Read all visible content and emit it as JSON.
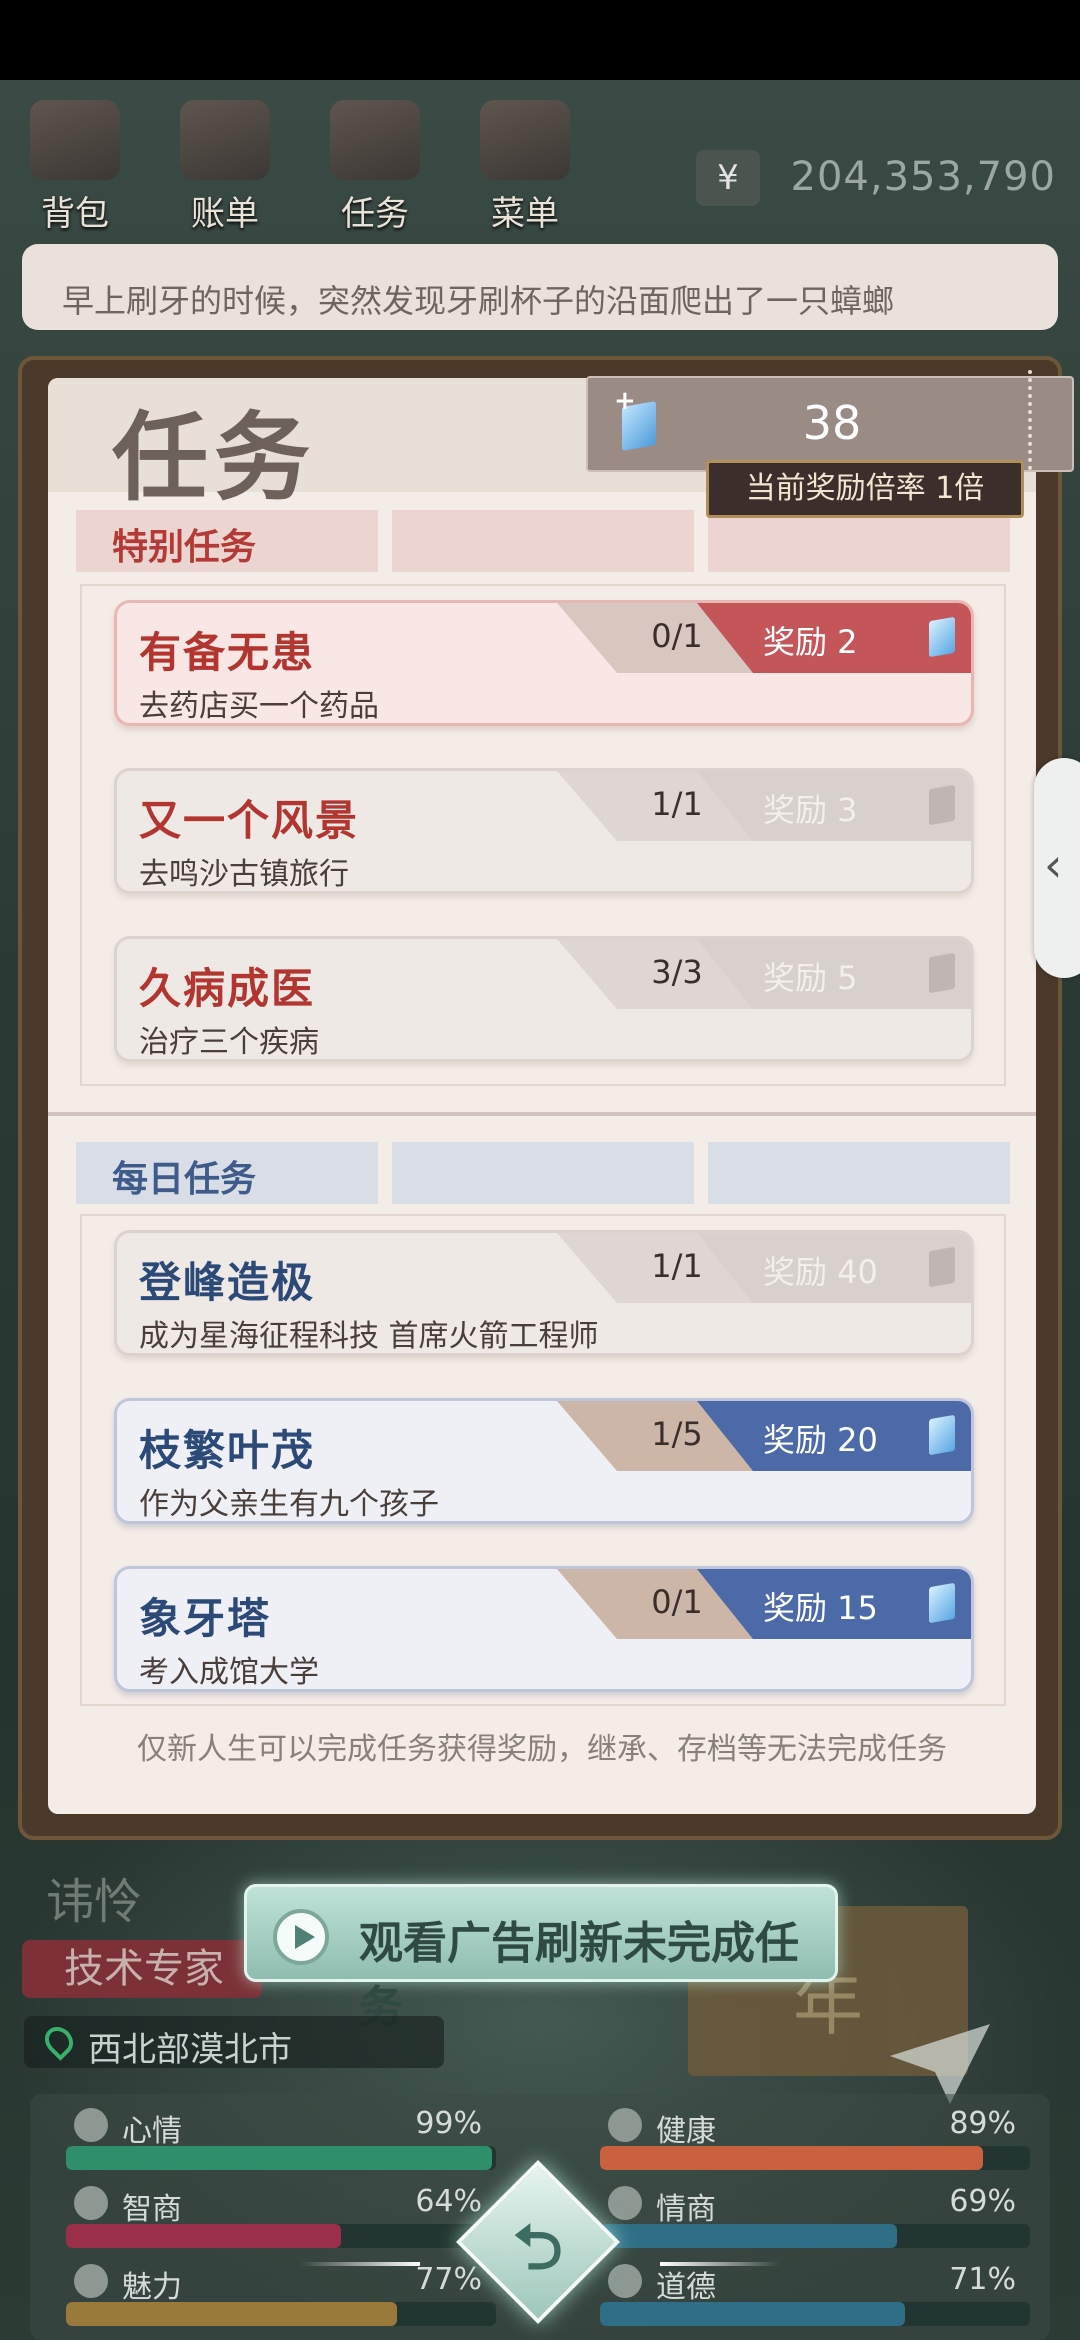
{
  "topbar": {
    "items": [
      {
        "label": "背包",
        "icon": "bag-icon"
      },
      {
        "label": "账单",
        "icon": "bill-icon"
      },
      {
        "label": "任务",
        "icon": "task-icon"
      },
      {
        "label": "菜单",
        "icon": "menu-icon"
      }
    ],
    "currency_symbol": "¥",
    "money": "204,353,790"
  },
  "story_text": "早上刷牙的时候，突然发现牙刷杯子的沿面爬出了一只蟑螂",
  "dialog": {
    "title": "任务",
    "points": "38",
    "multiplier_label": "当前奖励倍率 1倍",
    "special_tab": "特别任务",
    "daily_tab": "每日任务",
    "special_tasks": [
      {
        "name": "有备无患",
        "desc": "去药店买一个药品",
        "progress": "0/1",
        "reward": "奖励 2",
        "state": "active"
      },
      {
        "name": "又一个风景",
        "desc": "去鸣沙古镇旅行",
        "progress": "1/1",
        "reward": "奖励 3",
        "state": "done"
      },
      {
        "name": "久病成医",
        "desc": "治疗三个疾病",
        "progress": "3/3",
        "reward": "奖励 5",
        "state": "done"
      }
    ],
    "daily_tasks": [
      {
        "name": "登峰造极",
        "desc": "成为星海征程科技 首席火箭工程师",
        "progress": "1/1",
        "reward": "奖励 40",
        "state": "done"
      },
      {
        "name": "枝繁叶茂",
        "desc": "作为父亲生有九个孩子",
        "progress": "1/5",
        "reward": "奖励 20",
        "state": "active"
      },
      {
        "name": "象牙塔",
        "desc": "考入成馆大学",
        "progress": "0/1",
        "reward": "奖励 15",
        "state": "active"
      }
    ],
    "footnote": "仅新人生可以完成任务获得奖励，继承、存档等无法完成任务"
  },
  "character": {
    "name": "讳怜",
    "role": "技术专家",
    "location": "西北部漠北市",
    "year_suffix": "年"
  },
  "ad_button": "观看广告刷新未完成任务",
  "stats": [
    {
      "label": "心情",
      "value": "99%",
      "fraction": 0.99,
      "color": "#2e8f6a",
      "icon": "smile-icon"
    },
    {
      "label": "健康",
      "value": "89%",
      "fraction": 0.89,
      "color": "#c9603e",
      "icon": "heart-icon"
    },
    {
      "label": "智商",
      "value": "64%",
      "fraction": 0.64,
      "color": "#9a2f4a",
      "icon": "bulb-icon"
    },
    {
      "label": "情商",
      "value": "69%",
      "fraction": 0.69,
      "color": "#2f6e86",
      "icon": "apple-icon"
    },
    {
      "label": "魅力",
      "value": "77%",
      "fraction": 0.77,
      "color": "#9a7a3a",
      "icon": "sparkle-icon"
    },
    {
      "label": "道德",
      "value": "71%",
      "fraction": 0.71,
      "color": "#2f6e86",
      "icon": "scale-icon"
    }
  ],
  "center_button_glyph": "⮌"
}
